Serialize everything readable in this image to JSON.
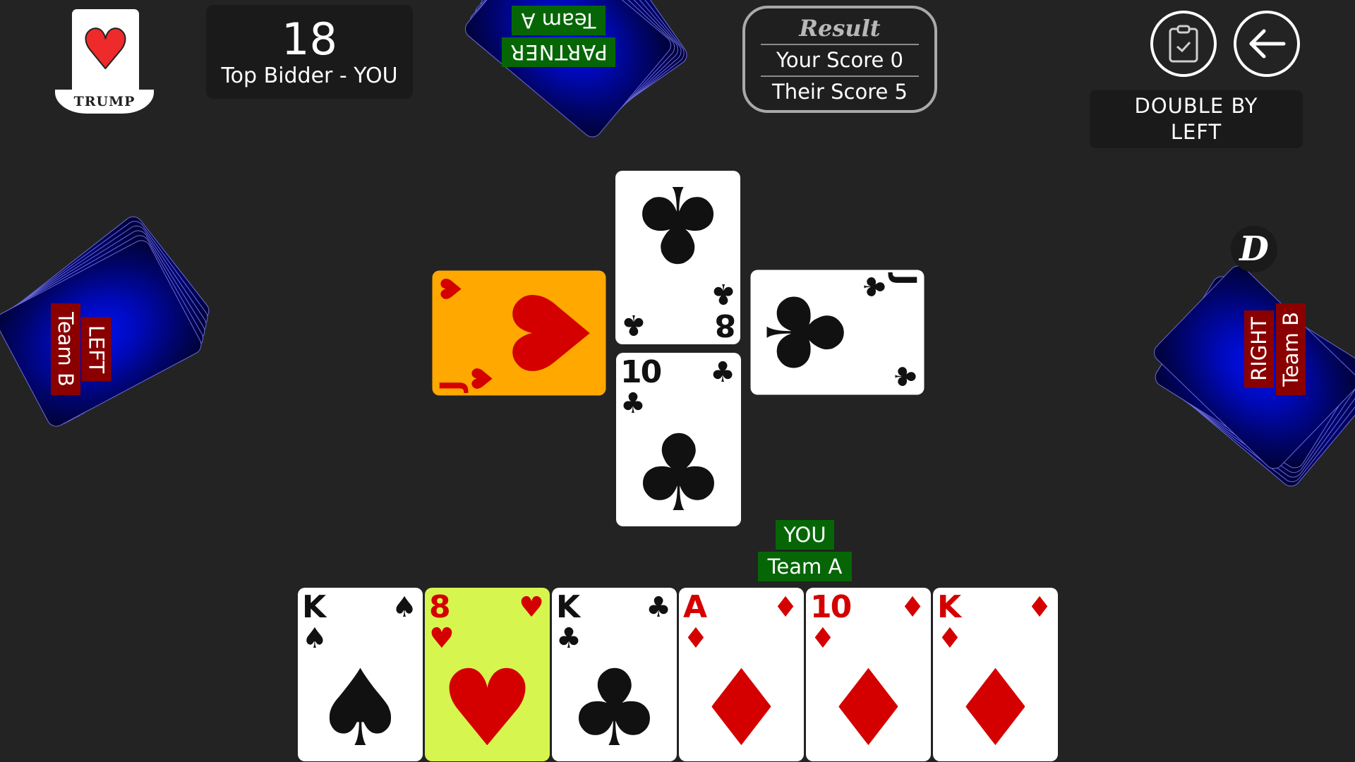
{
  "trump": {
    "suit_symbol": "♥",
    "suit": "hearts",
    "label": "TRUMP"
  },
  "bid": {
    "value": "18",
    "label": "Top Bidder - YOU"
  },
  "result": {
    "title": "Result",
    "your_score": "Your Score 0",
    "their_score": "Their Score 5"
  },
  "toolbar": {
    "clipboard_icon": "clipboard-check-icon",
    "back_icon": "arrow-left-icon"
  },
  "status": {
    "double_text_line1": "DOUBLE BY",
    "double_text_line2": "LEFT"
  },
  "dealer_badge": {
    "label": "D"
  },
  "players": {
    "partner": {
      "name": "PARTNER",
      "team": "Team A"
    },
    "left": {
      "name": "LEFT",
      "team": "Team B"
    },
    "right": {
      "name": "RIGHT",
      "team": "Team B"
    },
    "you": {
      "name": "YOU",
      "team": "Team A"
    }
  },
  "table": {
    "partner_card": {
      "rank": "8",
      "suit": "♣",
      "suit_name": "clubs"
    },
    "left_card": {
      "rank": "J",
      "suit": "♥",
      "suit_name": "hearts",
      "highlight": "#ffa800"
    },
    "right_card": {
      "rank": "J",
      "suit": "♣",
      "suit_name": "clubs"
    },
    "you_card": {
      "rank": "10",
      "suit": "♣",
      "suit_name": "clubs"
    }
  },
  "hand": [
    {
      "rank": "K",
      "suit": "♠",
      "suit_name": "spades",
      "color": "black"
    },
    {
      "rank": "8",
      "suit": "♥",
      "suit_name": "hearts",
      "color": "red",
      "selected": true
    },
    {
      "rank": "K",
      "suit": "♣",
      "suit_name": "clubs",
      "color": "black"
    },
    {
      "rank": "A",
      "suit": "♦",
      "suit_name": "diamonds",
      "color": "red"
    },
    {
      "rank": "10",
      "suit": "♦",
      "suit_name": "diamonds",
      "color": "red"
    },
    {
      "rank": "K",
      "suit": "♦",
      "suit_name": "diamonds",
      "color": "red"
    }
  ],
  "colors": {
    "background": "#232323",
    "team_a": "#066606",
    "team_b": "#8a0000",
    "selected_card": "#d6f54f",
    "played_highlight": "#ffa800"
  }
}
